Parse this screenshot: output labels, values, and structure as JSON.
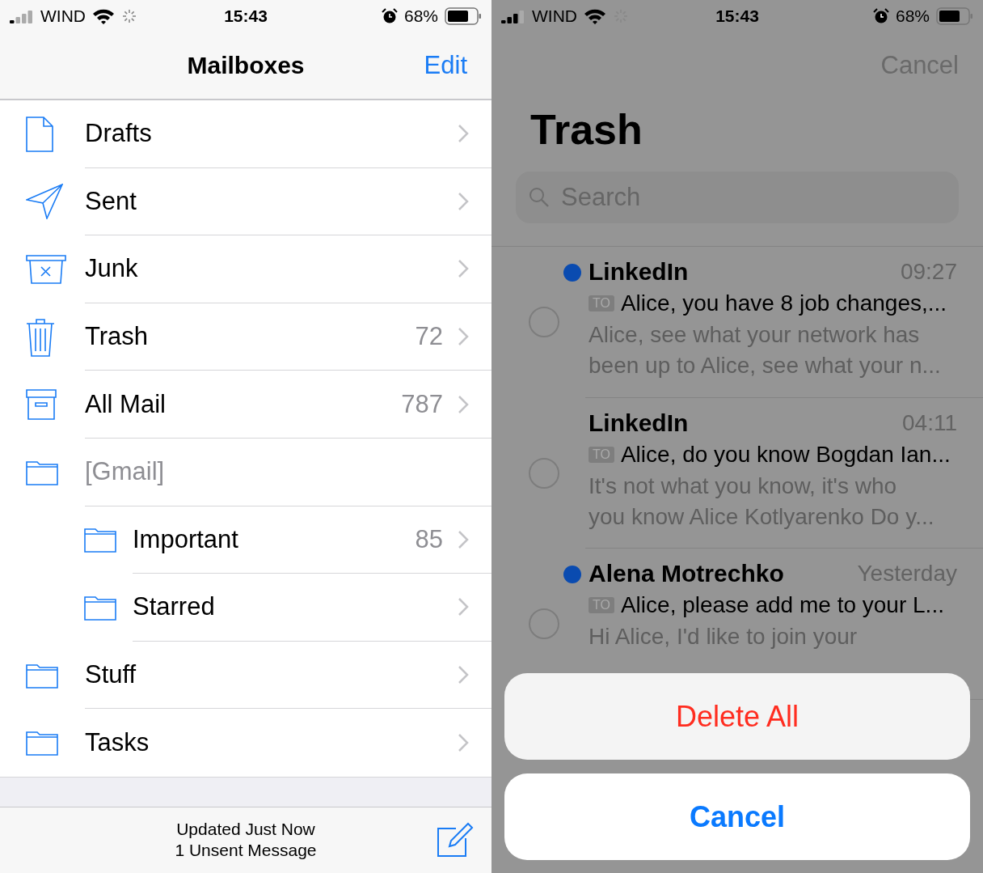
{
  "screens": [
    {
      "status": {
        "carrier": "WIND",
        "time": "15:43",
        "battery": "68%"
      },
      "nav": {
        "title": "Mailboxes",
        "action": "Edit"
      },
      "mailboxes": [
        {
          "kind": "draft",
          "label": "Drafts",
          "disabled": false
        },
        {
          "kind": "sent",
          "label": "Sent",
          "disabled": false
        },
        {
          "kind": "junk",
          "label": "Junk",
          "disabled": false
        },
        {
          "kind": "trash",
          "label": "Trash",
          "count": "72",
          "disabled": false
        },
        {
          "kind": "archive",
          "label": "All Mail",
          "count": "787",
          "disabled": false
        },
        {
          "kind": "folder",
          "label": "[Gmail]",
          "disabled": true,
          "children": [
            {
              "kind": "folder",
              "label": "Important",
              "count": "85",
              "disabled": false
            },
            {
              "kind": "folder",
              "label": "Starred",
              "disabled": false
            }
          ]
        },
        {
          "kind": "folder",
          "label": "Stuff",
          "disabled": false
        },
        {
          "kind": "folder",
          "label": "Tasks",
          "disabled": false
        }
      ],
      "toolbar": {
        "lines": [
          "Updated Just Now",
          "1 Unsent Message"
        ]
      }
    },
    {
      "status": {
        "carrier": "WIND",
        "time": "15:43",
        "battery": "68%"
      },
      "nav": {
        "action": "Cancel",
        "title": "Trash"
      },
      "search": {
        "placeholder": "Search"
      },
      "messages": [
        {
          "unread": true,
          "sender": "LinkedIn",
          "time": "09:27",
          "badge": "TO",
          "subject": "Alice, you have 8 job changes,...",
          "preview": [
            "Alice, see what your network has",
            "been up to Alice, see what your n..."
          ]
        },
        {
          "unread": false,
          "sender": "LinkedIn",
          "time": "04:11",
          "badge": "TO",
          "subject": "Alice, do you know Bogdan Ian...",
          "preview": [
            "It's not what you know, it's who",
            "you know Alice Kotlyarenko Do y..."
          ]
        },
        {
          "unread": true,
          "sender": "Alena Motrechko",
          "time": "Yesterday",
          "badge": "TO",
          "subject": "Alice, please add me to your L...",
          "preview": [
            "Hi Alice, I'd like to join your"
          ]
        }
      ],
      "action_sheet": {
        "actions": [
          {
            "label": "Delete All",
            "kind": "destructive"
          }
        ],
        "cancel": "Cancel"
      }
    }
  ]
}
